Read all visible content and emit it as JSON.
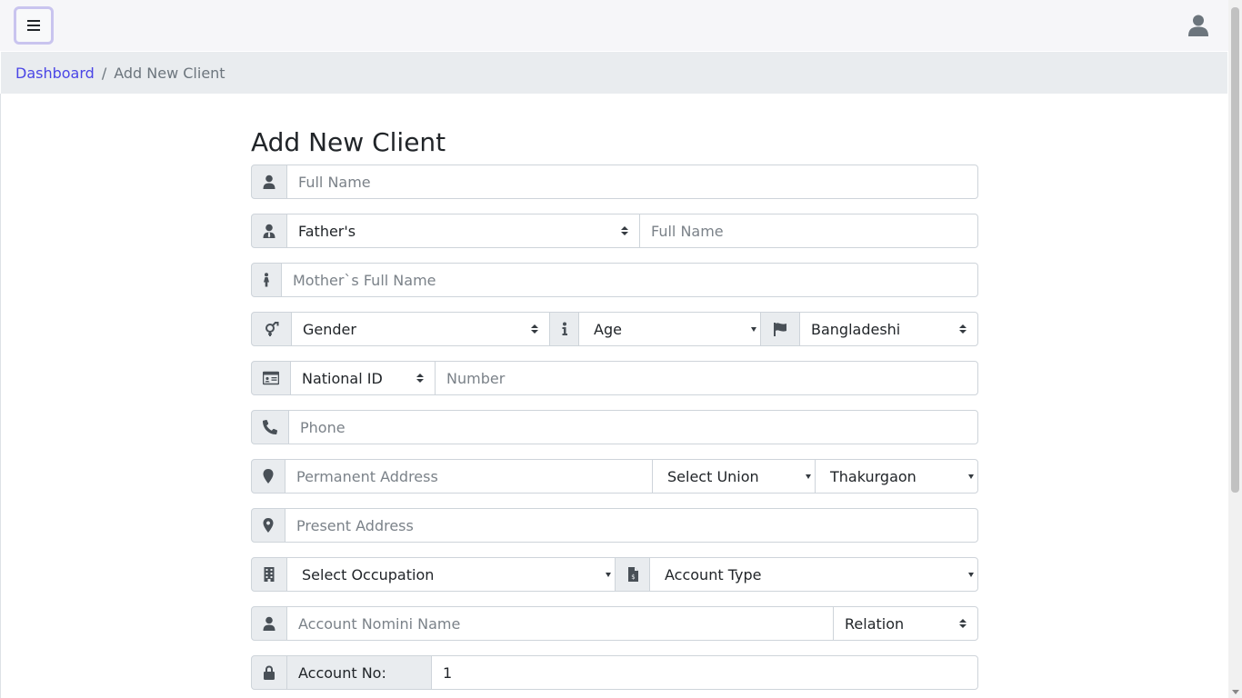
{
  "header": {
    "menu_icon": "hamburger-icon",
    "user_icon": "user-icon"
  },
  "breadcrumb": {
    "home": "Dashboard",
    "separator": "/",
    "current": "Add New Client"
  },
  "form": {
    "title": "Add New Client",
    "full_name_placeholder": "Full Name",
    "guardian_select": "Father's",
    "guardian_name_placeholder": "Full Name",
    "mother_name_placeholder": "Mother`s Full Name",
    "gender_select": "Gender",
    "age_select": "Age",
    "nationality_select": "Bangladeshi",
    "id_type_select": "National ID",
    "id_number_placeholder": "Number",
    "phone_placeholder": "Phone",
    "permanent_address_placeholder": "Permanent Address",
    "union_select": "Select Union",
    "district_select": "Thakurgaon",
    "present_address_placeholder": "Present Address",
    "occupation_select": "Select Occupation",
    "account_type_select": "Account Type",
    "nominee_placeholder": "Account Nomini Name",
    "relation_select": "Relation",
    "account_no_label": "Account No:",
    "account_no_value": "1"
  },
  "colors": {
    "link": "#4a45e6",
    "addon_bg": "#e9ecef",
    "border": "#ced4da",
    "menu_border": "#c9c4ef"
  }
}
